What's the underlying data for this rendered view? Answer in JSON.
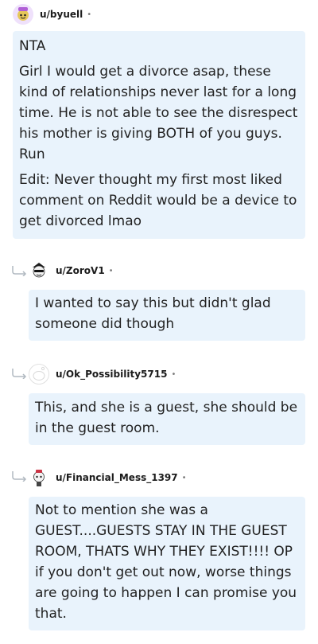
{
  "comments": [
    {
      "username": "u/byuell",
      "dot": "•",
      "paragraphs": [
        "NTA",
        "Girl I would get a divorce asap, these kind of relationships never last for a long time. He is not able to see the disrespect his mother is giving BOTH of you guys. Run",
        "Edit: Never thought my first most liked comment on Reddit would be a device to get divorced lmao"
      ]
    },
    {
      "username": "u/ZoroV1",
      "dot": "•",
      "paragraphs": [
        "I wanted to say this but didn't glad someone did though"
      ]
    },
    {
      "username": "u/Ok_Possibility5715",
      "dot": "•",
      "paragraphs": [
        "This, and she is a guest, she should be in the guest room."
      ]
    },
    {
      "username": "u/Financial_Mess_1397",
      "dot": "•",
      "paragraphs": [
        "Not to mention she was a GUEST....GUESTS STAY IN THE GUEST ROOM, THATS WHY THEY EXIST!!!! OP if you don't get out now, worse things are going to happen I can promise you that."
      ]
    }
  ],
  "colors": {
    "bubble": "#e9f3fc",
    "username": "#1c1c1c",
    "meta": "#7c7c7c"
  }
}
